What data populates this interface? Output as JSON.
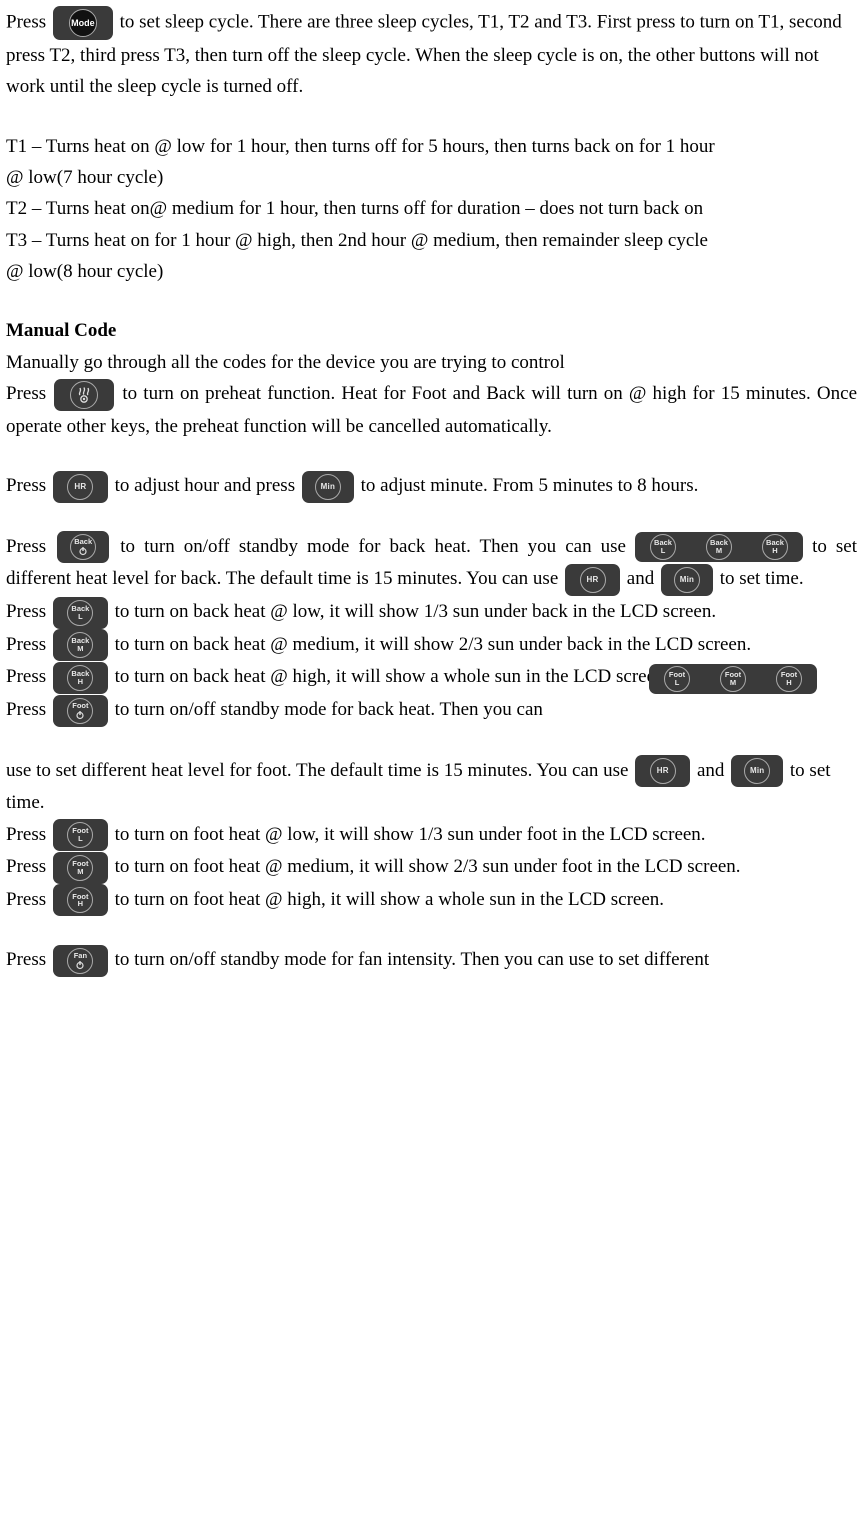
{
  "icons": {
    "mode": "Mode",
    "preheat": "preheat-icon",
    "hr": "HR",
    "min": "Min",
    "back_pwr_top": "Back",
    "back_l_top": "Back",
    "back_l_bot": "L",
    "back_m_top": "Back",
    "back_m_bot": "M",
    "back_h_top": "Back",
    "back_h_bot": "H",
    "foot_pwr_top": "Foot",
    "foot_l_top": "Foot",
    "foot_l_bot": "L",
    "foot_m_top": "Foot",
    "foot_m_bot": "M",
    "foot_h_top": "Foot",
    "foot_h_bot": "H",
    "fan_pwr_top": "Fan"
  },
  "p1": {
    "a": "Press",
    "b": " to set sleep cycle. There are three sleep cycles, T1, T2 and T3. First press to turn on T1, second press T2, third press T3, then turn off the sleep cycle. When the sleep cycle is on, the other buttons will not work until the sleep cycle is turned off."
  },
  "t1a": "T1 – Turns heat on @ low for 1 hour, then turns off for 5 hours, then turns back on for 1 hour",
  "t1b": "@ low(7 hour cycle)",
  "t2": "T2 – Turns heat on@ medium for 1 hour, then turns off for duration – does not turn back on",
  "t3a": "T3 – Turns heat on for 1 hour @ high, then 2nd hour @ medium, then remainder sleep cycle",
  "t3b": "@ low(8 hour cycle)",
  "manual_heading": "Manual Code",
  "manual_sub": "Manually go through all the codes for the device you are trying to control",
  "preheat": {
    "a": "Press ",
    "b": " to turn on preheat function. Heat for Foot and Back will turn on @ high for 15 minutes. Once operate other keys, the preheat function will be cancelled automatically."
  },
  "hrmin": {
    "a": "Press",
    "b": " to adjust hour and press ",
    "c": "to adjust minute. From 5 minutes to 8 hours."
  },
  "back_standby": {
    "a": "Press",
    "b": " to turn on/off standby mode for back heat. Then you can use ",
    "c": " to set different heat level for back. The default time is 15 minutes. You can use ",
    "d": " and ",
    "e": " to set time."
  },
  "back_l": {
    "a": "Press",
    "b": " to turn on back heat @ low, it will show 1/3 sun under back in the LCD screen."
  },
  "back_m": {
    "a": "Press",
    "b": "to turn on back heat @ medium, it will show 2/3 sun under back in the LCD screen."
  },
  "back_h": {
    "a": "Press",
    "b": "to turn on back heat @ high, it will show a whole sun in the LCD screen."
  },
  "foot_standby": {
    "a": "Press",
    "b": " to turn on/off standby mode for back heat. Then you can "
  },
  "foot_use": {
    "a": "use to set different heat level for foot. The default time is 15 minutes. You can use ",
    "b": " and",
    "c": " to set time."
  },
  "foot_l": {
    "a": "Press",
    "b": "  to turn on foot heat @ low, it will show 1/3 sun under foot in the LCD screen."
  },
  "foot_m": {
    "a": "Press",
    "b": " to turn on foot heat @ medium, it will show 2/3 sun under foot in the LCD screen."
  },
  "foot_h": {
    "a": "Press",
    "b": " to turn on foot heat @ high, it will show a whole sun in the LCD screen."
  },
  "fan": {
    "a": "Press",
    "b": " to turn on/off standby mode for fan intensity. Then you can use  to set different"
  }
}
